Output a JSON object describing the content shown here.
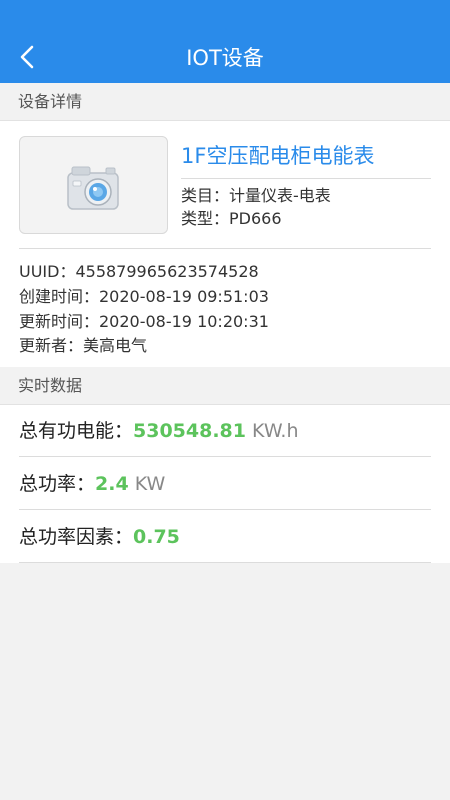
{
  "header": {
    "title": "IOT设备",
    "back_icon": "chevron-left-icon"
  },
  "detail_section": {
    "label": "设备详情"
  },
  "device": {
    "image_icon": "camera-icon",
    "name": "1F空压配电柜电能表",
    "category": "类目：计量仪表-电表",
    "type": "类型：PD666",
    "uuid": "UUID：455879965623574528",
    "created": "创建时间：2020-08-19 09:51:03",
    "updated": "更新时间：2020-08-19 10:20:31",
    "updater": "更新者：美高电气"
  },
  "realtime_section": {
    "label": "实时数据"
  },
  "metrics": [
    {
      "label": "总有功电能：",
      "value": "530548.81",
      "unit": "KW.h"
    },
    {
      "label": "总功率：",
      "value": "2.4",
      "unit": "KW"
    },
    {
      "label": "总功率因素：",
      "value": "0.75",
      "unit": ""
    }
  ],
  "colors": {
    "header": "#2a8bea",
    "value": "#5cc35c",
    "link": "#2a8bea"
  }
}
